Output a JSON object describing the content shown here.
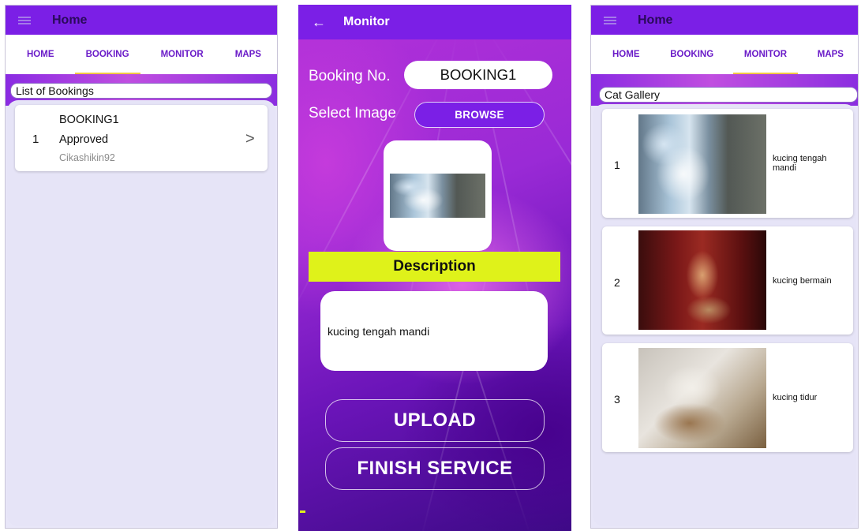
{
  "colors": {
    "primary": "#7b1fe6",
    "tab_text": "#6a1bc8",
    "tab_indicator": "#f2c744",
    "description_bg": "#dff21a",
    "panel": "#e6e4f7"
  },
  "screen1": {
    "appbar": {
      "menu_icon": "menu-icon",
      "title": "Home"
    },
    "tabs": [
      "HOME",
      "BOOKING",
      "MONITOR",
      "MAPS"
    ],
    "active_tab": "BOOKING",
    "section_title": "List of Bookings",
    "bookings": [
      {
        "index": "1",
        "booking_no": "BOOKING1",
        "status": "Approved",
        "user": "Cikashikin92",
        "chevron": ">"
      }
    ]
  },
  "screen2": {
    "appbar": {
      "back_icon": "arrow-back-icon",
      "title": "Monitor"
    },
    "booking_label": "Booking No.",
    "booking_value": "BOOKING1",
    "select_image_label": "Select Image",
    "browse_label": "BROWSE",
    "description_label": "Description",
    "description_text": "kucing tengah mandi",
    "upload_label": "UPLOAD",
    "finish_label": "FINISH SERVICE"
  },
  "screen3": {
    "appbar": {
      "menu_icon": "menu-icon",
      "title": "Home"
    },
    "tabs": [
      "HOME",
      "BOOKING",
      "MONITOR",
      "MAPS"
    ],
    "active_tab": "MONITOR",
    "section_title": "Cat Gallery",
    "gallery": [
      {
        "index": "1",
        "caption": "kucing tengah mandi"
      },
      {
        "index": "2",
        "caption": "kucing bermain"
      },
      {
        "index": "3",
        "caption": "kucing tidur"
      }
    ]
  }
}
